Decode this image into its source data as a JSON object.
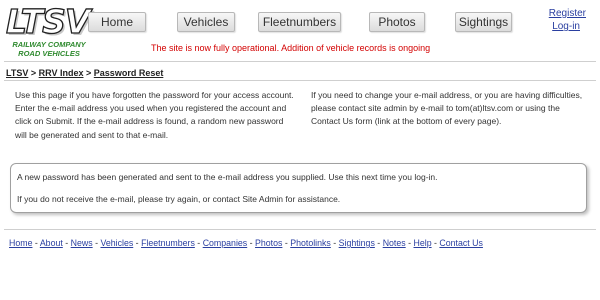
{
  "logo": {
    "mark": "LTSV",
    "line1": "RAILWAY COMPANY",
    "line2": "ROAD VEHICLES"
  },
  "nav": [
    {
      "label": "Home"
    },
    {
      "label": "Vehicles"
    },
    {
      "label": "Fleetnumbers"
    },
    {
      "label": "Photos"
    },
    {
      "label": "Sightings"
    }
  ],
  "account": {
    "register": "Register",
    "login": "Log-in"
  },
  "notice": "The site is now fully operational. Addition of vehicle records is ongoing",
  "breadcrumb": {
    "home": "LTSV",
    "sep1": ">",
    "index": "RRV Index",
    "sep2": ">",
    "current": "Password Reset"
  },
  "intro": {
    "left": "Use this page if you have forgotten the password for your access account. Enter the e-mail address you used when you registered the account and click on Submit. If the e-mail address is found, a random new password will be generated and sent to that e-mail.",
    "right": "If you need to change your e-mail address, or you are having difficulties, please contact site admin by e-mail to tom(at)ltsv.com or using the Contact Us form (link at the bottom of every page)."
  },
  "message": {
    "line1": "A new password has been generated and sent to the e-mail address you supplied. Use this next time you log-in.",
    "line2": "If you do not receive the e-mail, please try again, or contact Site Admin for assistance."
  },
  "footer": {
    "separator": " - ",
    "links": [
      "Home",
      "About",
      "News",
      "Vehicles",
      "Fleetnumbers",
      "Companies",
      "Photos",
      "Photolinks",
      "Sightings",
      "Notes",
      "Help",
      "Contact Us"
    ]
  },
  "colors": {
    "link": "#2a3fa0",
    "notice": "#d30000",
    "logo_sub": "#2f8a2f"
  }
}
